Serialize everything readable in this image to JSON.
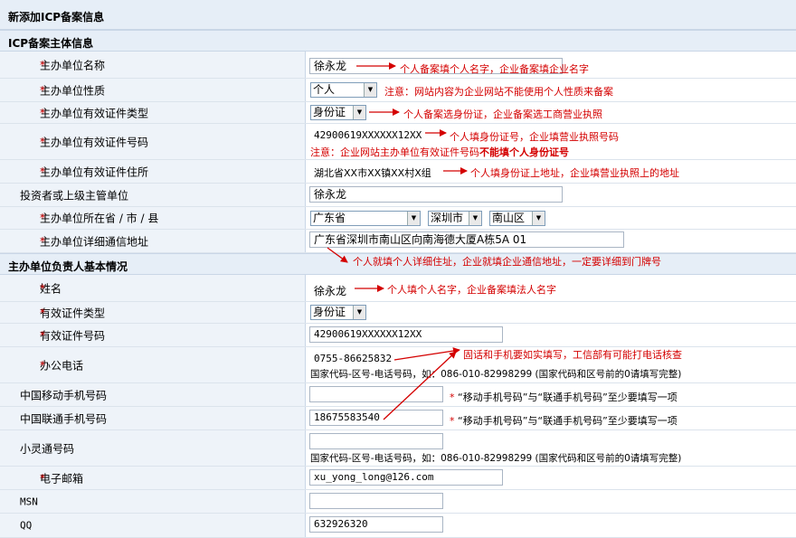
{
  "header": {
    "title": "新添加ICP备案信息"
  },
  "section1": {
    "title": "ICP备案主体信息"
  },
  "section2": {
    "title": "主办单位负责人基本情况"
  },
  "fields": {
    "org_name": {
      "label": "主办单位名称",
      "value": "徐永龙",
      "annotation": "个人备案填个人名字，企业备案填企业名字"
    },
    "org_nature": {
      "label": "主办单位性质",
      "value": "个人",
      "annotation": "注意：网站内容为企业网站不能使用个人性质来备案"
    },
    "org_cert_type": {
      "label": "主办单位有效证件类型",
      "value": "身份证",
      "annotation": "个人备案选身份证，企业备案选工商营业执照"
    },
    "org_cert_no": {
      "label": "主办单位有效证件号码",
      "value": "42900619XXXXXX12XX",
      "annotation": "个人填身份证号，企业填营业执照号码",
      "warning_prefix": "注意：企业网站主办单位有效证件号码",
      "warning_bold": "不能填个人身份证号"
    },
    "org_cert_addr": {
      "label": "主办单位有效证件住所",
      "value": "湖北省XX市XX镇XX村X组",
      "annotation": "个人填身份证上地址，企业填营业执照上的地址"
    },
    "investor": {
      "label": "投资者或上级主管单位",
      "value": "徐永龙"
    },
    "region": {
      "label": "主办单位所在省 / 市 / 县",
      "province": "广东省",
      "city": "深圳市",
      "county": "南山区"
    },
    "address": {
      "label": "主办单位详细通信地址",
      "value": "广东省深圳市南山区向南海德大厦A栋5A 01",
      "annotation": "个人就填个人详细住址，企业就填企业通信地址，一定要详细到门牌号"
    },
    "person_name": {
      "label": "姓名",
      "value": "徐永龙",
      "annotation": "个人填个人名字，企业备案填法人名字"
    },
    "person_cert_type": {
      "label": "有效证件类型",
      "value": "身份证"
    },
    "person_cert_no": {
      "label": "有效证件号码",
      "value": "42900619XXXXXX12XX"
    },
    "office_phone": {
      "label": "办公电话",
      "value": "0755-86625832",
      "annotation": "固话和手机要如实填写，工信部有可能打电话核查",
      "hint": "国家代码-区号-电话号码，如：086-010-82998299 (国家代码和区号前的0请填写完整)"
    },
    "mobile_cmcc": {
      "label": "中国移动手机号码",
      "value": "",
      "hint": "“移动手机号码”与“联通手机号码”至少要填写一项"
    },
    "mobile_unicom": {
      "label": "中国联通手机号码",
      "value": "18675583540",
      "hint": "“移动手机号码”与“联通手机号码”至少要填写一项"
    },
    "phs": {
      "label": "小灵通号码",
      "value": "",
      "hint": "国家代码-区号-电话号码，如：086-010-82998299 (国家代码和区号前的0请填写完整)"
    },
    "email": {
      "label": "电子邮箱",
      "value": "xu_yong_long@126.com"
    },
    "msn": {
      "label": "MSN",
      "value": ""
    },
    "qq": {
      "label": "QQ",
      "value": "632926320"
    }
  },
  "required_mark": "*",
  "colors": {
    "accent_red": "#d40000",
    "header_bg": "#e6eef7",
    "label_bg": "#eef3f9"
  }
}
